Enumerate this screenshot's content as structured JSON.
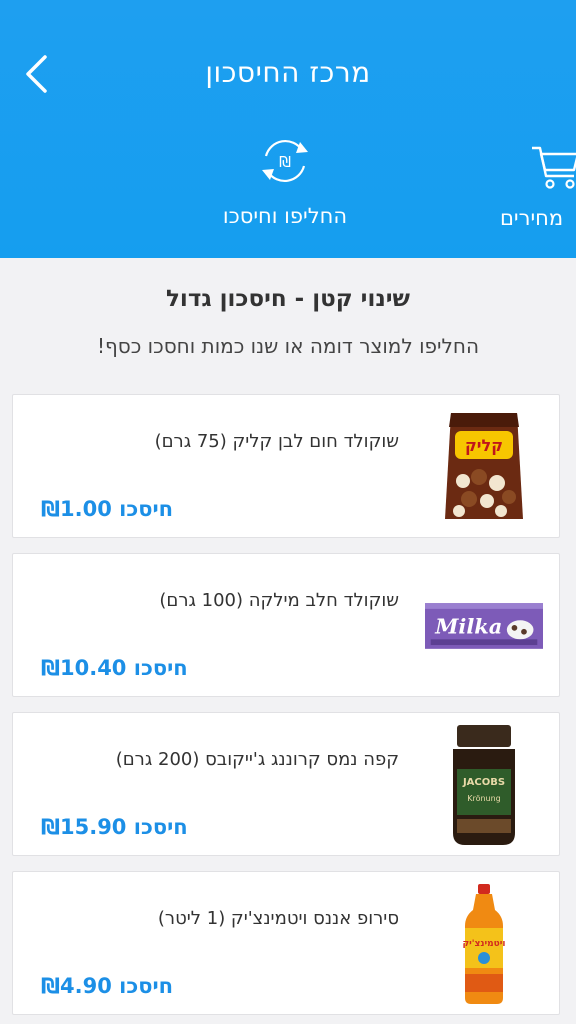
{
  "header": {
    "title": "מרכז החיסכון",
    "back_icon": "chevron-left-icon",
    "tabs": [
      {
        "label": "מחירים",
        "icon": "cart-icon"
      },
      {
        "label": "החליפו וחיסכו",
        "icon": "swap-shekel-icon"
      }
    ],
    "background_color": "#1e9ff0"
  },
  "intro": {
    "title": "שינוי קטן - חיסכון גדול",
    "subtitle": "החליפו למוצר דומה או שנו כמות וחסכו כסף!"
  },
  "accent_color": "#1c8fe6",
  "products": [
    {
      "name": "שוקולד חום לבן קליק (75 גרם)",
      "saving": "חיסכו ₪1.00",
      "image": "klik-chocolate-bag"
    },
    {
      "name": "שוקולד חלב מילקה (100 גרם)",
      "saving": "חיסכו ₪10.40",
      "image": "milka-bar"
    },
    {
      "name": "קפה נמס קרוננג ג'ייקובס (200 גרם)",
      "saving": "חיסכו ₪15.90",
      "image": "jacobs-coffee-jar"
    },
    {
      "name": "סירופ אננס ויטמינצ'יק (1 ליטר)",
      "saving": "חיסכו ₪4.90",
      "image": "syrup-bottle"
    }
  ]
}
